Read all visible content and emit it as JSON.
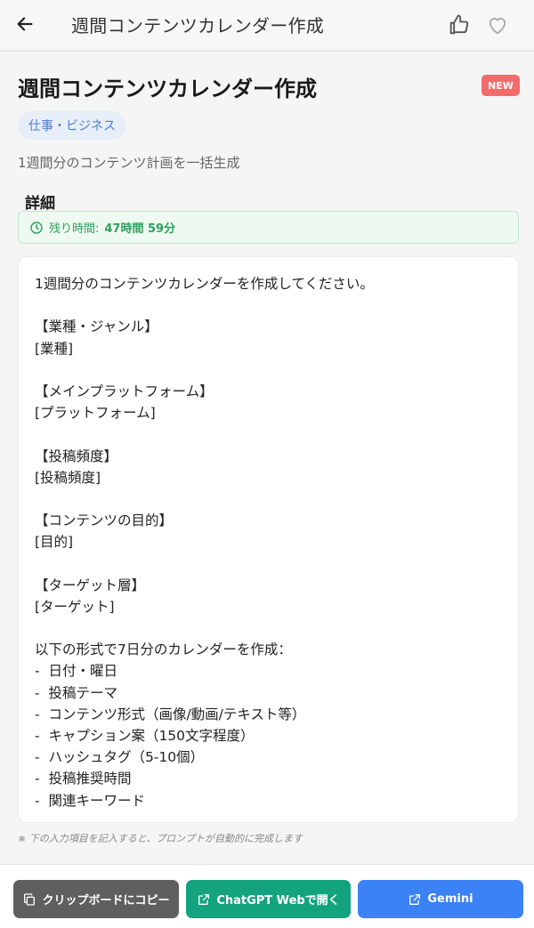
{
  "header": {
    "title": "週間コンテンツカレンダー作成",
    "back_icon": "arrow-left-icon",
    "like_icon": "thumbs-up-icon",
    "favorite_icon": "heart-icon"
  },
  "main": {
    "title": "週間コンテンツカレンダー作成",
    "badge": "NEW",
    "category": "仕事・ビジネス",
    "description": "1週間分のコンテンツ計画を一括生成",
    "details_heading": "詳細",
    "timer": {
      "icon": "clock-icon",
      "label": "残り時間:",
      "value": "47時間 59分"
    },
    "prompt_lines": [
      "1週間分のコンテンツカレンダーを作成してください。",
      "",
      "【業種・ジャンル】",
      "[業種]",
      "",
      "【メインプラットフォーム】",
      "[プラットフォーム]",
      "",
      "【投稿頻度】",
      "[投稿頻度]",
      "",
      "【コンテンツの目的】",
      "[目的]",
      "",
      "【ターゲット層】",
      "[ターゲット]",
      "",
      "以下の形式で7日分のカレンダーを作成：",
      "-  日付・曜日",
      "-  投稿テーマ",
      "-  コンテンツ形式（画像/動画/テキスト等）",
      "-  キャプション案（150文字程度）",
      "-  ハッシュタグ（5-10個）",
      "-  投稿推奨時間",
      "-  関連キーワード"
    ],
    "footnote": "※ 下の入力項目を記入すると、プロンプトが自動的に完成します"
  },
  "actions": {
    "copy_label": "クリップボードにコピー",
    "chatgpt_label": "ChatGPT Webで開く",
    "gemini_label": "Gemini",
    "copy_icon": "copy-icon",
    "external_icon": "external-link-icon"
  },
  "colors": {
    "badge": "#f46b6b",
    "chip_text": "#4a7fd0",
    "timer_green": "#2e9f5e",
    "copy_button": "#5f5f5f",
    "chatgpt_button": "#14a37f",
    "gemini_button": "#3b82f6"
  }
}
